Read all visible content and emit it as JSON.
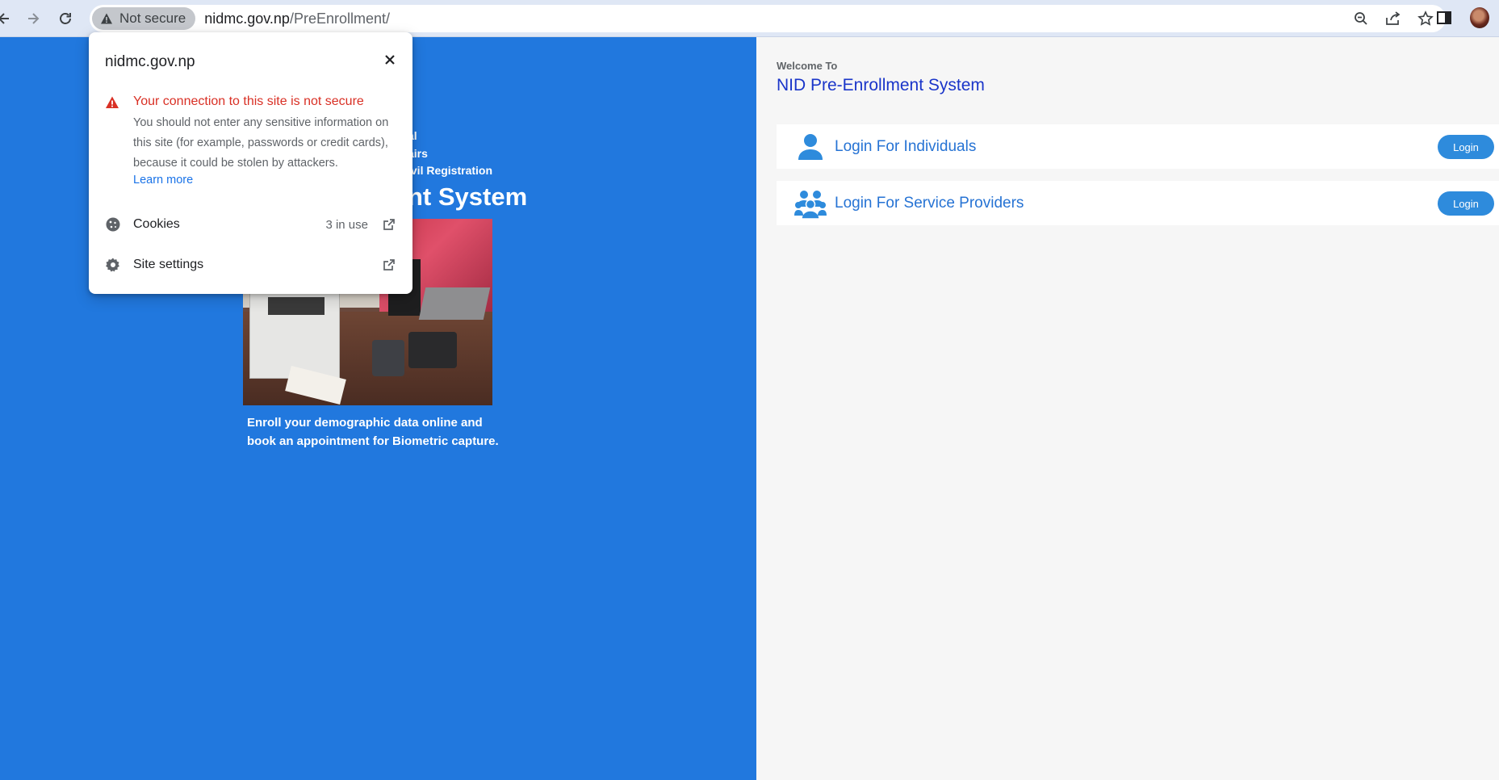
{
  "browser": {
    "security_chip_label": "Not secure",
    "url_domain": "nidmc.gov.np",
    "url_path": "/PreEnrollment/"
  },
  "left": {
    "org_lines": [
      "al",
      "airs",
      "ivil Registration"
    ],
    "system_title": "nt System",
    "tagline": "Enroll your demographic data online and book an appointment for Biometric capture."
  },
  "right": {
    "welcome_small": "Welcome To",
    "welcome_title": "NID Pre-Enrollment System",
    "cards": [
      {
        "label": "Login For Individuals",
        "button": "Login",
        "icon": "user-icon"
      },
      {
        "label": "Login For Service Providers",
        "button": "Login",
        "icon": "users-group-icon"
      }
    ]
  },
  "popup": {
    "domain": "nidmc.gov.np",
    "warning_title": "Your connection to this site is not secure",
    "warning_body": "You should not enter any sensitive information on this site (for example, passwords or credit cards), because it could be stolen by attackers.",
    "learn_more": "Learn more",
    "rows": [
      {
        "label": "Cookies",
        "value": "3 in use",
        "icon": "cookie-icon"
      },
      {
        "label": "Site settings",
        "value": "",
        "icon": "gear-icon"
      }
    ]
  },
  "colors": {
    "left_panel": "#2178de",
    "right_panel": "#f6f6f6",
    "title_blue": "#1a35c9",
    "link_blue": "#2673d4",
    "login_button": "#2e8bdc",
    "warning_red": "#d93025"
  }
}
